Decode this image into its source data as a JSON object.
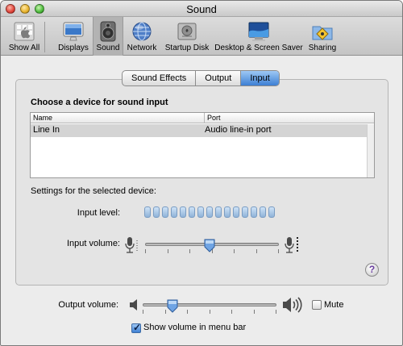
{
  "window": {
    "title": "Sound"
  },
  "toolbar": {
    "items": [
      {
        "label": "Show All",
        "icon": "apple-logo-icon"
      },
      {
        "label": "Displays",
        "icon": "monitor-icon"
      },
      {
        "label": "Sound",
        "icon": "speaker-icon",
        "selected": true
      },
      {
        "label": "Network",
        "icon": "network-globe-icon"
      },
      {
        "label": "Startup Disk",
        "icon": "hard-disk-icon"
      },
      {
        "label": "Desktop & Screen Saver",
        "icon": "desktop-screen-icon"
      },
      {
        "label": "Sharing",
        "icon": "sharing-folder-icon"
      }
    ]
  },
  "tabs": [
    {
      "label": "Sound Effects"
    },
    {
      "label": "Output"
    },
    {
      "label": "Input",
      "active": true
    }
  ],
  "input_section": {
    "title": "Choose a device for sound input",
    "columns": [
      "Name",
      "Port"
    ],
    "rows": [
      {
        "name": "Line In",
        "port": "Audio line-in port",
        "selected": true
      }
    ]
  },
  "settings": {
    "title": "Settings for the selected device:",
    "input_level_label": "Input level:",
    "input_level_segments": 15,
    "input_volume_label": "Input volume:",
    "input_volume": 0.48
  },
  "output": {
    "volume_label": "Output volume:",
    "volume": 0.2,
    "mute_label": "Mute",
    "mute_checked": false,
    "show_volume_label": "Show volume in menu bar",
    "show_volume_checked": true
  },
  "help_label": "?",
  "colors": {
    "accent": "#3d7fd3",
    "selected_row": "#d4d4d4",
    "window_bg": "#ececec"
  }
}
